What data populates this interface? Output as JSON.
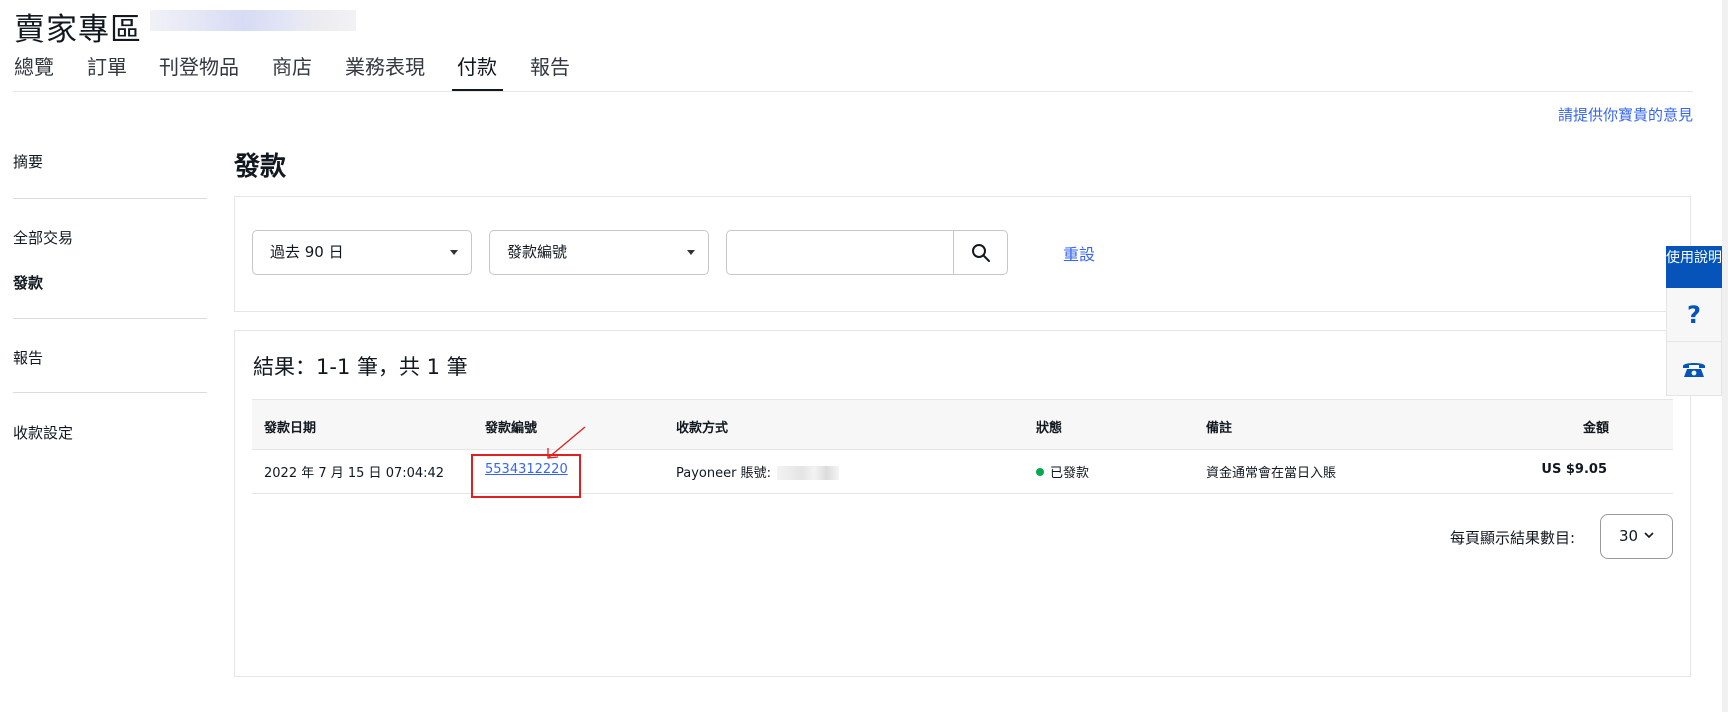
{
  "header": {
    "title": "賣家專區"
  },
  "top_nav": {
    "tabs": [
      {
        "label": "總覽"
      },
      {
        "label": "訂單"
      },
      {
        "label": "刊登物品"
      },
      {
        "label": "商店"
      },
      {
        "label": "業務表現"
      },
      {
        "label": "付款",
        "active": true
      },
      {
        "label": "報告"
      }
    ]
  },
  "feedback_link": "請提供你寶貴的意見",
  "sidebar": {
    "items": [
      {
        "label": "摘要"
      },
      {
        "label": "全部交易"
      },
      {
        "label": "發款",
        "active": true
      },
      {
        "label": "報告"
      },
      {
        "label": "收款設定"
      }
    ]
  },
  "page": {
    "title": "發款"
  },
  "filters": {
    "period_select": "過去 90 日",
    "field_select": "發款編號",
    "search_value": "",
    "reset_label": "重設"
  },
  "results": {
    "summary": "結果：1-1 筆，共 1 筆",
    "columns": {
      "date": "發款日期",
      "id": "發款編號",
      "method": "收款方式",
      "status": "狀態",
      "note": "備註",
      "amount": "金額"
    },
    "rows": [
      {
        "date": "2022 年 7 月 15 日 07:04:42",
        "id": "5534312220",
        "method": "Payoneer 賬號:",
        "status": "已發款",
        "note": "資金通常會在當日入賬",
        "amount": "US $9.05"
      }
    ],
    "per_page_label": "每頁顯示結果數目:",
    "per_page_value": "30"
  },
  "help_widget": {
    "title": "使用說明",
    "help_icon": "question-icon",
    "phone_icon": "phone-icon"
  },
  "colors": {
    "link": "#3665f3",
    "status_paid": "#05a951",
    "help_blue": "#0654ba",
    "annotation_red": "#e02020"
  }
}
